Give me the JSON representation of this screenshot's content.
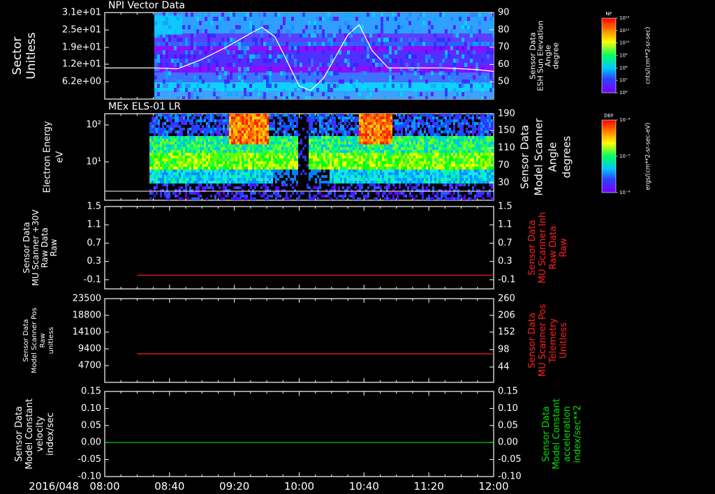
{
  "chart_data": [
    {
      "type": "heatmap",
      "title": "NPI Vector Data",
      "ylabel": "Sector\nUnitless",
      "yticks": [
        "3.1e+01",
        "2.5e+01",
        "1.9e+01",
        "1.2e+01",
        "6.2e+00"
      ],
      "ylabel_right": "Sensor Data\nESH Sun Elevation\nAngle\ndegree",
      "yticks_right": [
        "90",
        "80",
        "70",
        "60",
        "50"
      ],
      "ylim_right": [
        40,
        90
      ],
      "colorbar": {
        "title": "NF",
        "unit": "cnts/(cm**2-sr-sec)",
        "ticks": [
          "10¹²",
          "10¹¹",
          "10¹⁰",
          "10⁹",
          "10⁸",
          "10⁷",
          "10⁶"
        ]
      },
      "overlay_line": {
        "color": "#ffffff",
        "x": [
          "08:00",
          "08:30",
          "08:45",
          "09:00",
          "09:15",
          "09:30",
          "09:37",
          "09:45",
          "09:52",
          "10:00",
          "10:07",
          "10:15",
          "10:30",
          "10:37",
          "10:45",
          "10:55",
          "11:30",
          "11:50",
          "12:00"
        ],
        "y": [
          58,
          58,
          57.5,
          63,
          70,
          78,
          81.5,
          76,
          63,
          47.5,
          45,
          52,
          77,
          83,
          68,
          58,
          58,
          57,
          56
        ]
      }
    },
    {
      "type": "heatmap",
      "title": "MEx ELS-01 LR",
      "ylabel": "Electron Energy\neV",
      "yticks": [
        "10²",
        "10¹"
      ],
      "ylabel_right": "Sensor Data\nModel Scanner\nAngle\ndegrees",
      "yticks_right": [
        "190",
        "150",
        "110",
        "70",
        "30"
      ],
      "colorbar": {
        "title": "DEF",
        "unit": "ergs/(cm**2-sr-sec-eV)",
        "ticks": [
          "10⁻⁴",
          "10⁻⁵",
          "10⁻⁶"
        ]
      }
    },
    {
      "type": "line",
      "ylabel": "Sensor Data\nMU Scanner +30V\nRaw Data\nRaw",
      "yticks": [
        "1.5",
        "1.1",
        "0.7",
        "0.3",
        "-0.1"
      ],
      "ylim": [
        -0.3,
        1.5
      ],
      "ylabel_right": "Sensor Data\nMU Scanner Inh\nRaw Data\nRaw",
      "yticks_right": [
        "1.5",
        "1.1",
        "0.7",
        "0.3",
        "-0.1"
      ],
      "series": [
        {
          "color": "#ff2020",
          "x": [
            "08:20",
            "12:00"
          ],
          "y": [
            0.0,
            0.0
          ]
        }
      ]
    },
    {
      "type": "line",
      "ylabel": "Sensor Data\nModel Scanner Pos\nRaw\nunitless",
      "yticks": [
        "23500",
        "18800",
        "14100",
        "9400",
        "4700"
      ],
      "ylim": [
        0,
        23500
      ],
      "ylabel_right": "Sensor Data\nMU Scanner Pos\nTelemetry\nUnitless",
      "yticks_right": [
        "260",
        "206",
        "152",
        "98",
        "44"
      ],
      "series": [
        {
          "color": "#ff2020",
          "x": [
            "08:20",
            "12:00"
          ],
          "y": [
            8000,
            8000
          ]
        }
      ]
    },
    {
      "type": "line",
      "ylabel": "Sensor Data\nModel Constant\nvelocity\nindex/sec",
      "yticks": [
        "0.15",
        "0.10",
        "0.05",
        "0.00",
        "-0.05",
        "-0.10"
      ],
      "ylim": [
        -0.1,
        0.15
      ],
      "ylabel_right": "Sensor Data\nModel Constant\nacceleration\nindex/sec**2",
      "yticks_right": [
        "0.15",
        "0.10",
        "0.05",
        "0.00",
        "-0.05",
        "-0.10"
      ],
      "series": [
        {
          "color": "#00e000",
          "x": [
            "08:00",
            "12:00"
          ],
          "y": [
            0.0,
            0.0
          ]
        }
      ]
    }
  ],
  "time_axis": {
    "date": "2016/048",
    "ticks": [
      "08:00",
      "08:40",
      "09:20",
      "10:00",
      "10:40",
      "11:20",
      "12:00"
    ]
  },
  "colors": {
    "right_label_panel3": "#ff2020",
    "right_label_panel4": "#ff2020",
    "right_label_panel5": "#00e000"
  }
}
